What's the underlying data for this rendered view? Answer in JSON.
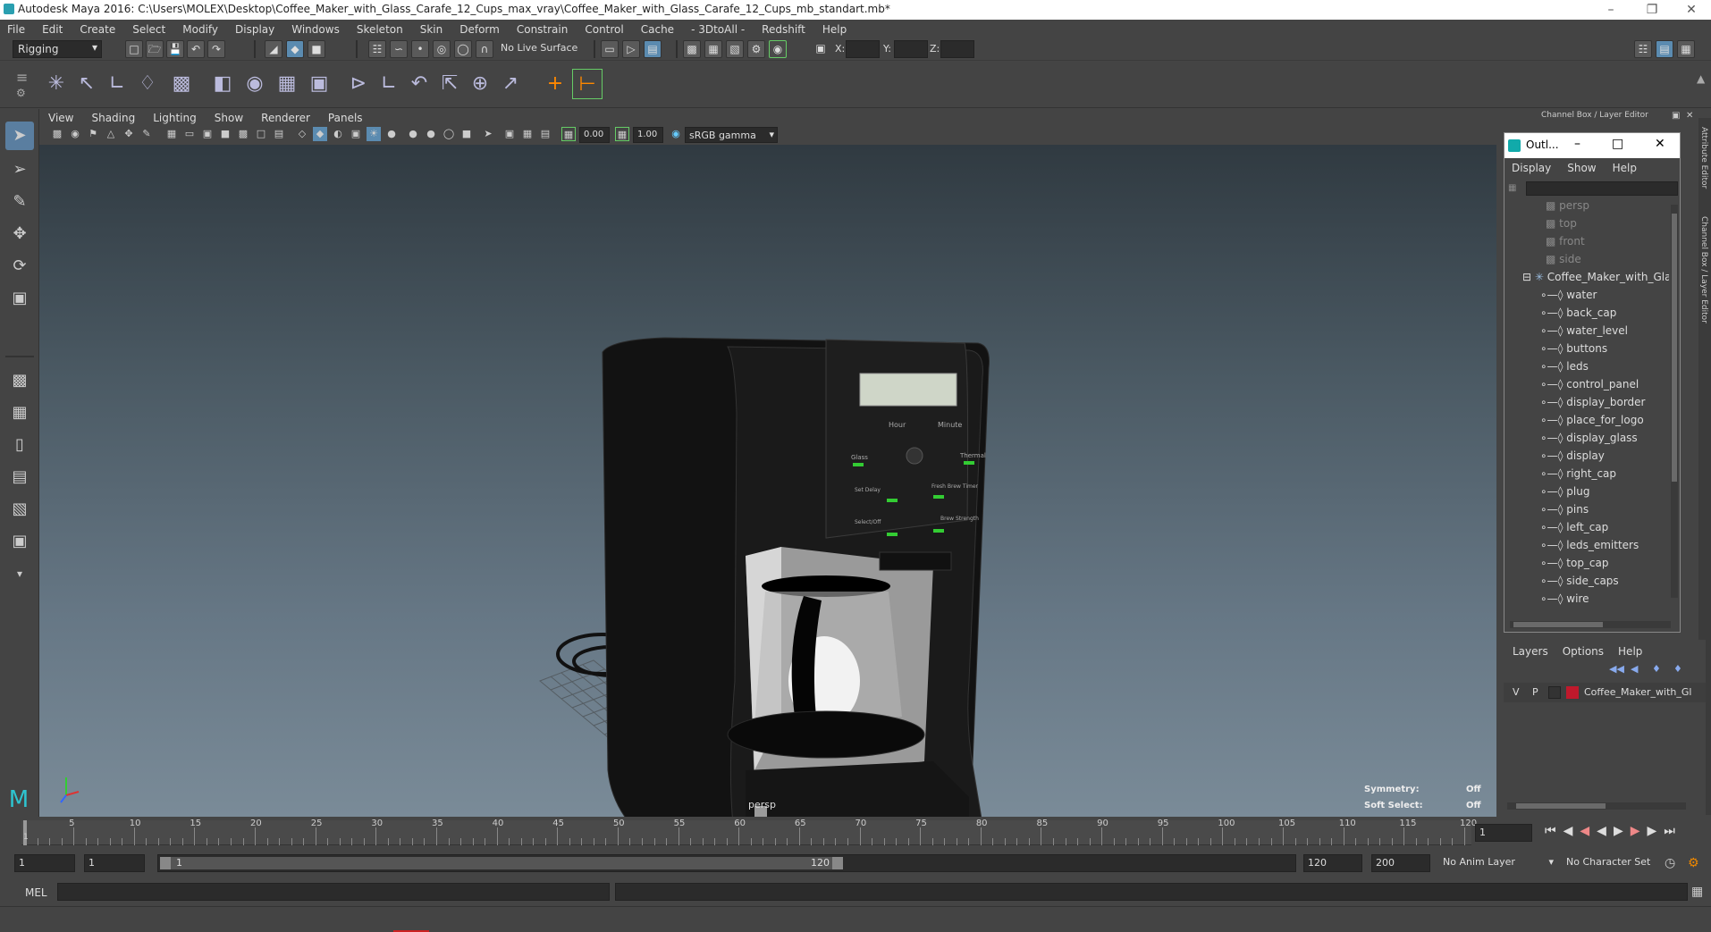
{
  "window": {
    "title": "Autodesk Maya 2016: C:\\Users\\MOLEX\\Desktop\\Coffee_Maker_with_Glass_Carafe_12_Cups_max_vray\\Coffee_Maker_with_Glass_Carafe_12_Cups_mb_standart.mb*"
  },
  "menubar": [
    "File",
    "Edit",
    "Create",
    "Select",
    "Modify",
    "Display",
    "Windows",
    "Skeleton",
    "Skin",
    "Deform",
    "Constrain",
    "Control",
    "Cache",
    "- 3DtoAll -",
    "Redshift",
    "Help"
  ],
  "statusline": {
    "menuset": "Rigging",
    "live_surface": "No Live Surface",
    "x_label": "X:",
    "y_label": "Y:",
    "z_label": "Z:"
  },
  "viewport": {
    "menus": [
      "View",
      "Shading",
      "Lighting",
      "Show",
      "Renderer",
      "Panels"
    ],
    "exposure": "0.00",
    "gamma": "1.00",
    "color_space": "sRGB gamma",
    "camera_label": "persp",
    "symmetry_label": "Symmetry:",
    "symmetry_value": "Off",
    "soft_select_label": "Soft Select:",
    "soft_select_value": "Off",
    "model_labels": {
      "hour": "Hour",
      "minute": "Minute",
      "glass": "Glass",
      "thermal": "Thermal",
      "set_delay": "Set Delay",
      "fresh_brew_timer": "Fresh Brew Timer",
      "select_off": "Select/Off",
      "brew_strength": "Brew Strength"
    }
  },
  "right_panel": {
    "header": "Channel Box / Layer Editor",
    "side_tabs": [
      "Attribute Editor",
      "Channel Box / Layer Editor"
    ]
  },
  "outliner": {
    "title": "Outl...",
    "menus": [
      "Display",
      "Show",
      "Help"
    ],
    "cameras": [
      "persp",
      "top",
      "front",
      "side"
    ],
    "group": "Coffee_Maker_with_Gla",
    "children": [
      "water",
      "back_cap",
      "water_level",
      "buttons",
      "leds",
      "control_panel",
      "display_border",
      "place_for_logo",
      "display_glass",
      "display",
      "right_cap",
      "plug",
      "pins",
      "left_cap",
      "leds_emitters",
      "top_cap",
      "side_caps",
      "wire"
    ]
  },
  "layers": {
    "menus": [
      "Layers",
      "Options",
      "Help"
    ],
    "layer": {
      "v": "V",
      "p": "P",
      "name": "Coffee_Maker_with_Gl",
      "color": "#c0192c"
    }
  },
  "timeline": {
    "ticks": [
      "5",
      "10",
      "15",
      "20",
      "25",
      "30",
      "35",
      "40",
      "45",
      "50",
      "55",
      "60",
      "65",
      "70",
      "75",
      "80",
      "85",
      "90",
      "95",
      "100",
      "105",
      "110",
      "115",
      "120"
    ],
    "current_frame_marker": "1",
    "current_frame": "1"
  },
  "range": {
    "start": "1",
    "playback_start": "1",
    "slider_start": "1",
    "slider_end": "120",
    "playback_end": "120",
    "end": "200",
    "anim_layer": "No Anim Layer",
    "character_set": "No Character Set"
  },
  "cmdline": {
    "label": "MEL"
  }
}
